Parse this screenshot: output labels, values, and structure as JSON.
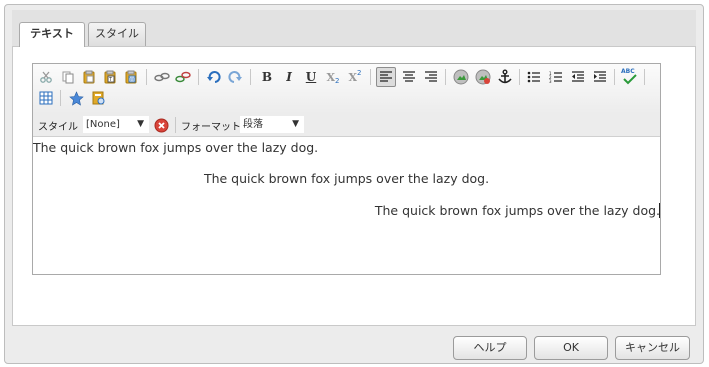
{
  "tabs": [
    {
      "label": "テキスト",
      "active": true
    },
    {
      "label": "スタイル",
      "active": false
    }
  ],
  "toolbar": {
    "icons": [
      "cut-icon",
      "copy-icon",
      "paste-icon",
      "paste-text-icon",
      "paste-word-icon",
      "link-icon",
      "unlink-icon",
      "undo-icon",
      "redo-icon",
      "bold-icon",
      "italic-icon",
      "underline-icon",
      "subscript-icon",
      "superscript-icon",
      "align-left-icon",
      "align-center-icon",
      "align-right-icon",
      "insert-image-icon",
      "remove-image-icon",
      "anchor-icon",
      "bullet-list-icon",
      "numbered-list-icon",
      "outdent-icon",
      "indent-icon",
      "spellcheck-icon",
      "table-icon",
      "special-char-icon",
      "find-replace-icon"
    ],
    "bold": "B",
    "italic": "I",
    "underline": "U",
    "subscript": "X",
    "superscript": "X",
    "spellcheck": "ABC"
  },
  "format_bar": {
    "style_label": "スタイル",
    "style_value": "[None]",
    "format_label": "フォーマット",
    "format_value": "段落"
  },
  "content": {
    "line1": "The quick brown fox jumps over the lazy dog.",
    "line2": "The quick brown fox jumps over the lazy dog.",
    "line3": "The quick brown fox jumps over the lazy dog."
  },
  "footer": {
    "help": "ヘルプ",
    "ok": "OK",
    "cancel": "キャンセル"
  },
  "colors": {
    "accent_blue": "#2a6ebd",
    "icon_gold": "#e0a928",
    "remove_red": "#d9443a"
  }
}
